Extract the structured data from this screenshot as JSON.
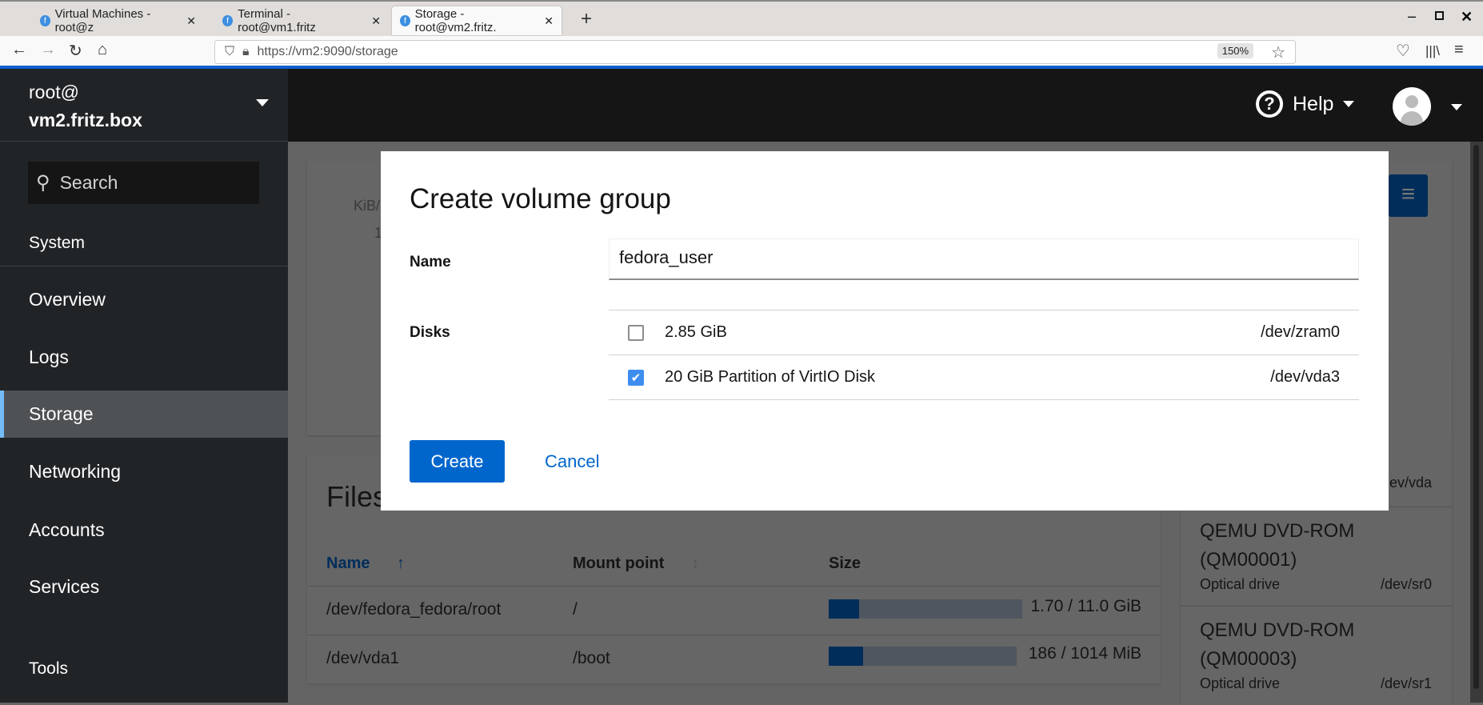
{
  "browser": {
    "tabs": [
      {
        "label": "Virtual Machines - root@z",
        "active": false
      },
      {
        "label": "Terminal - root@vm1.fritz",
        "active": false
      },
      {
        "label": "Storage - root@vm2.fritz.",
        "active": true
      }
    ],
    "url": "https://vm2:9090/storage",
    "zoom": "150%"
  },
  "sidebar": {
    "user": "root@",
    "host": "vm2.fritz.box",
    "search_placeholder": "Search",
    "section_system": "System",
    "items": [
      "Overview",
      "Logs",
      "Storage",
      "Networking",
      "Accounts",
      "Services"
    ],
    "active": "Storage",
    "section_tools": "Tools"
  },
  "header": {
    "help": "Help"
  },
  "background": {
    "chart_fragments": [
      "KiB/",
      "1"
    ],
    "filesystems_title": "Files",
    "table": {
      "columns": [
        "Name",
        "Mount point",
        "Size"
      ],
      "sort_column": "Name",
      "rows": [
        {
          "name": "/dev/fedora_fedora/root",
          "mount": "/",
          "size": "1.70 / 11.0 GiB",
          "usage_fraction": 0.155
        },
        {
          "name": "/dev/vda1",
          "mount": "/boot",
          "size": "186 / 1014 MiB",
          "usage_fraction": 0.183
        }
      ]
    },
    "drives": [
      {
        "dev": "ev/vda"
      },
      {
        "name": "QEMU DVD-ROM (QM00001)",
        "type": "Optical drive",
        "dev": "/dev/sr0"
      },
      {
        "name": "QEMU DVD-ROM (QM00003)",
        "type": "Optical drive",
        "dev": "/dev/sr1"
      }
    ]
  },
  "dialog": {
    "title": "Create volume group",
    "name_label": "Name",
    "name_value": "fedora_user",
    "disks_label": "Disks",
    "disks": [
      {
        "label": "2.85 GiB",
        "dev": "/dev/zram0",
        "checked": false
      },
      {
        "label": "20 GiB Partition of VirtIO Disk",
        "dev": "/dev/vda3",
        "checked": true
      }
    ],
    "create": "Create",
    "cancel": "Cancel"
  },
  "colors": {
    "accent": "#0066cc",
    "sidebar": "#212427",
    "header": "#151515"
  }
}
